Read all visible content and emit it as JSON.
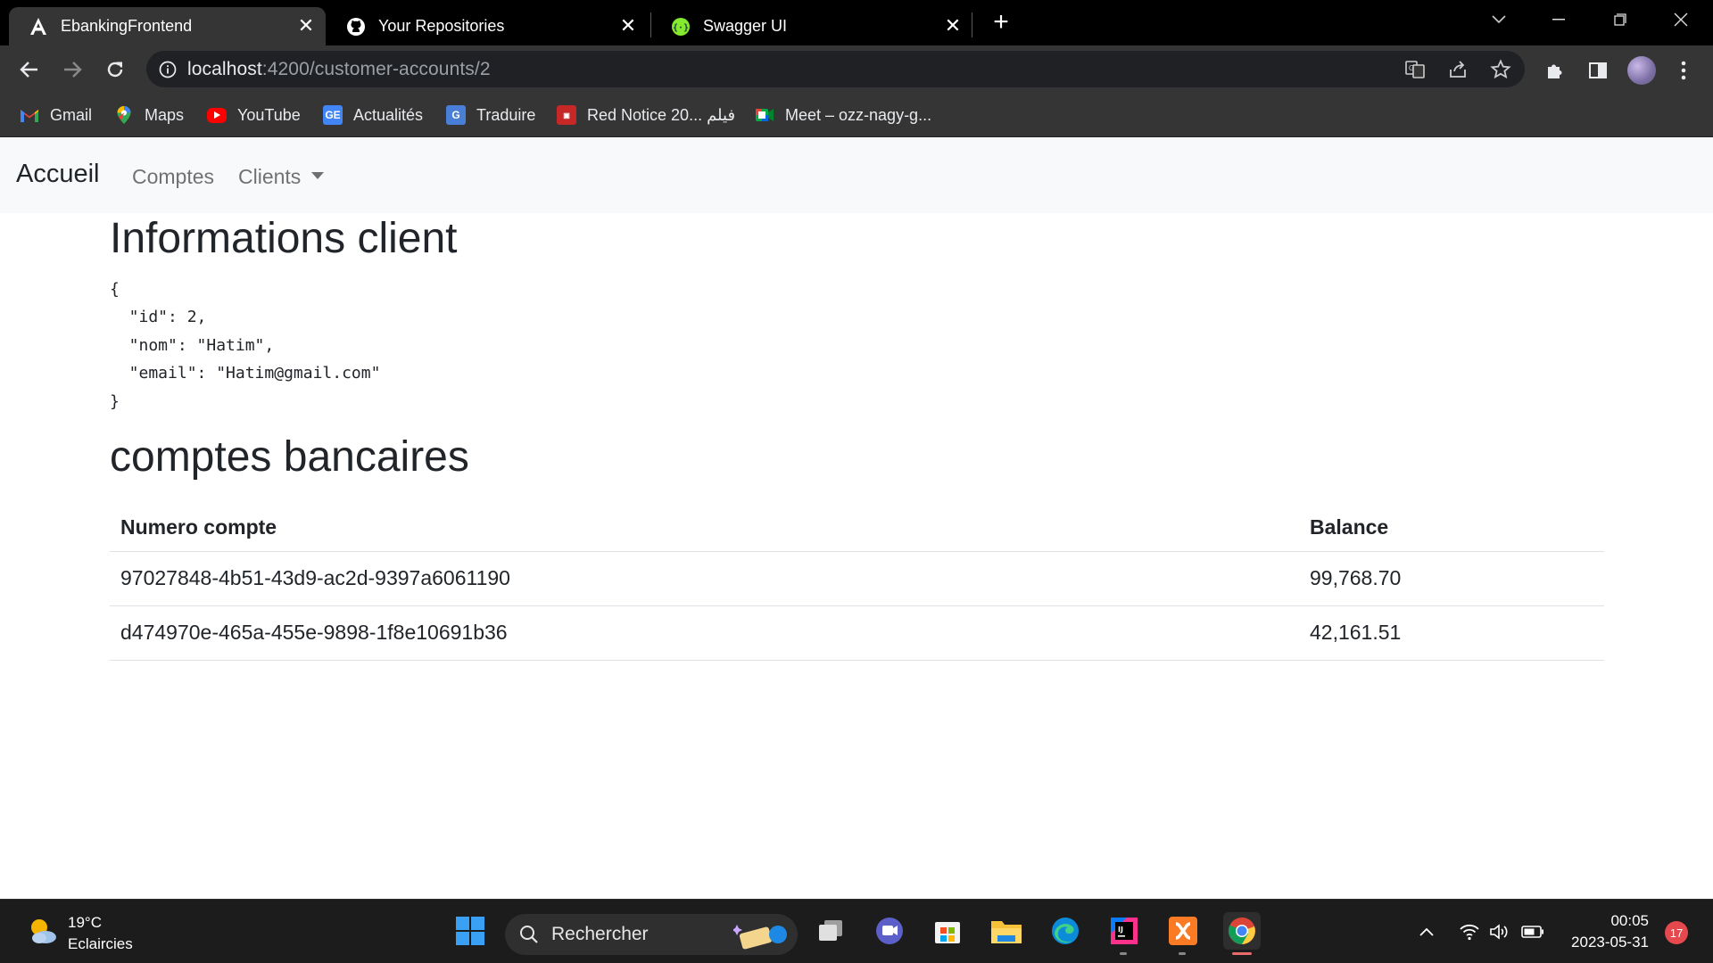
{
  "browser": {
    "tabs": [
      {
        "title": "EbankingFrontend",
        "icon": "angular-icon",
        "active": true
      },
      {
        "title": "Your Repositories",
        "icon": "github-icon",
        "active": false
      },
      {
        "title": "Swagger UI",
        "icon": "swagger-icon",
        "active": false
      }
    ],
    "url_host": "localhost",
    "url_rest": ":4200/customer-accounts/2",
    "bookmarks": [
      {
        "label": "Gmail",
        "icon": "gmail-icon"
      },
      {
        "label": "Maps",
        "icon": "maps-icon"
      },
      {
        "label": "YouTube",
        "icon": "youtube-icon"
      },
      {
        "label": "Actualités",
        "icon": "news-icon"
      },
      {
        "label": "Traduire",
        "icon": "translate-icon"
      },
      {
        "label": "Red Notice 20... فيلم",
        "icon": "movie-icon"
      },
      {
        "label": "Meet – ozz-nagy-g...",
        "icon": "meet-icon"
      }
    ]
  },
  "navbar": {
    "brand": "Accueil",
    "links": [
      "Comptes",
      "Clients"
    ]
  },
  "customer": {
    "heading": "Informations client",
    "json_lines": [
      "{",
      "  \"id\": 2,",
      "  \"nom\": \"Hatim\",",
      "  \"email\": \"Hatim@gmail.com\"",
      "}"
    ]
  },
  "accounts": {
    "heading": "comptes bancaires",
    "columns": [
      "Numero compte",
      "Balance"
    ],
    "rows": [
      {
        "id": "97027848-4b51-43d9-ac2d-9397a6061190",
        "balance": "99,768.70"
      },
      {
        "id": "d474970e-465a-455e-9898-1f8e10691b36",
        "balance": "42,161.51"
      }
    ]
  },
  "taskbar": {
    "temperature": "19°C",
    "weather": "Eclaircies",
    "search_placeholder": "Rechercher",
    "time": "00:05",
    "date": "2023-05-31",
    "notifications": "17"
  }
}
